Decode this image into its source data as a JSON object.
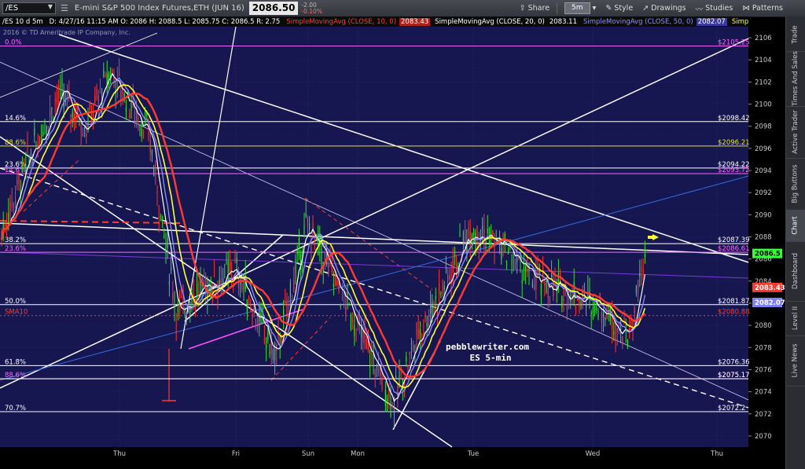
{
  "toolbar": {
    "symbol": "/ES",
    "description": "E-mini S&P 500 Index Futures,ETH (JUN 16)",
    "last_price": "2086.50",
    "net_change": "-2.00",
    "pct_change": "-0.10%",
    "timeframe": "5m",
    "share": "Share",
    "style": "Style",
    "drawings": "Drawings",
    "studies": "Studies",
    "patterns": "Patterns",
    "icons": [
      "share-icon",
      "timeframe-icon",
      "style-icon",
      "drawings-icon",
      "studies-icon",
      "patterns-icon"
    ]
  },
  "studies_bar": {
    "header": "/ES 10 d 5m",
    "quote": "D: 4/27/16 11:15 AM  O: 2086  H: 2088.5  L: 2085.75  C: 2086.5  R: 2.75",
    "sma10_label": "SimpleMovingAvg (CLOSE, 10, 0)",
    "sma10_value": "2083.43",
    "sma20_label": "SimpleMovingAvg (CLOSE, 20, 0)",
    "sma20_value": "2083.11",
    "sma50_label": "SimpleMovingAvg (CLOSE, 50, 0)",
    "sma50_value": "2082.07",
    "sma100_label": "SimpleMovingAvg (",
    "colors": {
      "sma10": "#ff3b2f",
      "sma20": "#ffffff",
      "sma50": "#7f7fff",
      "sma100": "#ffff33"
    }
  },
  "sidebar_tabs": [
    "Trade",
    "Times And Sales",
    "Active Trader",
    "Big Buttons",
    "Chart",
    "Dashboard",
    "Level II",
    "Live News"
  ],
  "sidebar_active": "Chart",
  "copyright": "2016 © TD Ameritrade IP Company, Inc.",
  "watermark": [
    "pebblewriter.com",
    "ES 5-min"
  ],
  "chart_data": {
    "type": "candlestick",
    "ylim": [
      2069,
      2107
    ],
    "y_ticks": [
      2070,
      2072,
      2074,
      2076,
      2078,
      2080,
      2082,
      2084,
      2086,
      2088,
      2090,
      2092,
      2094,
      2096,
      2098,
      2100,
      2102,
      2104,
      2106
    ],
    "x_tick_labels": [
      "Thu",
      "Fri",
      "Sun",
      "Mon",
      "Tue",
      "Wed",
      "Thu"
    ],
    "price_levels": [
      {
        "value": 2105.25,
        "label": "$2105.25",
        "left": "0.0%",
        "color": "#ff66ff"
      },
      {
        "value": 2098.42,
        "label": "$2098.42",
        "left": "14.6%",
        "color": "#ffffff"
      },
      {
        "value": 2096.21,
        "label": "$2096.21",
        "left": "88.6%",
        "color": "#e6e61a"
      },
      {
        "value": 2094.22,
        "label": "$2094.22",
        "left": "23.6%",
        "color": "#ffffff"
      },
      {
        "value": 2093.72,
        "label": "$2093.72",
        "left": "14.6%",
        "color": "#ff66ff"
      },
      {
        "value": 2087.39,
        "label": "$2087.39",
        "left": "38.2%",
        "color": "#ffffff"
      },
      {
        "value": 2086.61,
        "label": "$2086.61",
        "left": "23.6%",
        "color": "#ff66ff"
      },
      {
        "value": 2081.87,
        "label": "$2081.87",
        "left": "50.0%",
        "color": "#ffffff"
      },
      {
        "value": 2080.88,
        "label": "$2080.88",
        "left": "SMA10",
        "color": "#ff3b2f"
      },
      {
        "value": 2076.36,
        "label": "$2076.36",
        "left": "61.8%",
        "color": "#ffffff"
      },
      {
        "value": 2075.17,
        "label": "$2075.17",
        "left": "88.6%",
        "color": "#ff66ff"
      },
      {
        "value": 2075.17,
        "label": "$2075.17",
        "left": "",
        "color": "#ffffff"
      },
      {
        "value": 2072.2,
        "label": "$2072.2",
        "left": "70.7%",
        "color": "#ffffff"
      }
    ],
    "price_markers": [
      {
        "value": 2086.5,
        "label": "2086.5",
        "color": "#33ff33"
      },
      {
        "value": 2083.43,
        "label": "2083.43",
        "color": "#ff3b2f"
      },
      {
        "value": 2082.07,
        "label": "2082.07",
        "color": "#7f7fff"
      }
    ]
  }
}
